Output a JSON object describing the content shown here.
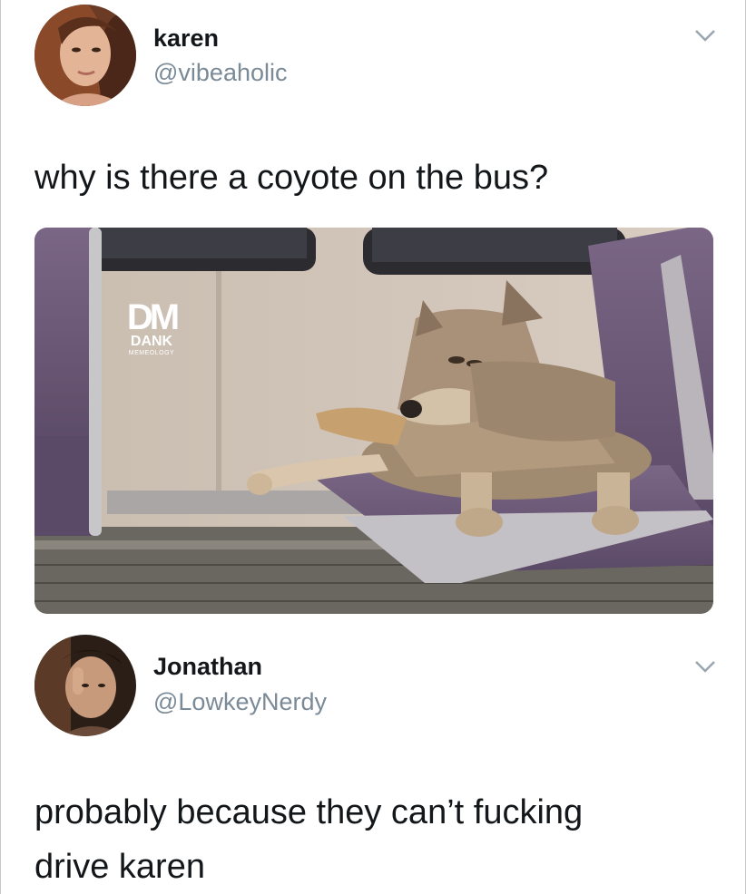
{
  "tweet1": {
    "name": "karen",
    "handle": "@vibeaholic",
    "text": "why is there a coyote on the bus?",
    "media": {
      "watermark_logo": "DM",
      "watermark_line1": "DANK",
      "watermark_line2": "MEMEOLOGY"
    }
  },
  "tweet2": {
    "name": "Jonathan",
    "handle": "@LowkeyNerdy",
    "text_line1": "probably because they can’t fucking",
    "text_line2": "drive karen"
  },
  "icons": {
    "menu": "chevron-down-icon"
  }
}
